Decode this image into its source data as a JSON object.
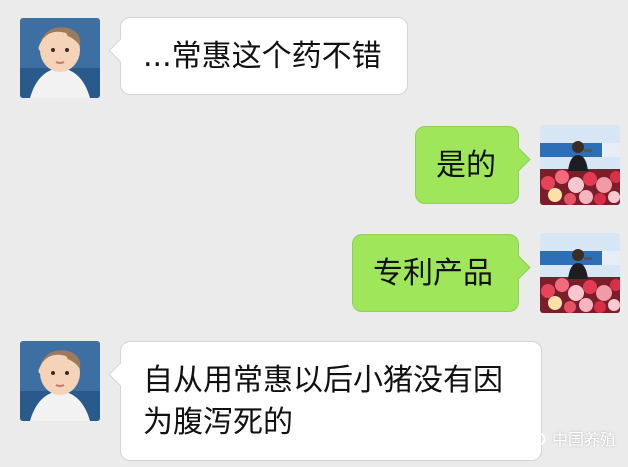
{
  "chat": {
    "messages": [
      {
        "side": "left",
        "sender": "baby-avatar",
        "text": "...常惠这个药不错"
      },
      {
        "side": "right",
        "sender": "speaker-avatar",
        "text": "是的"
      },
      {
        "side": "right",
        "sender": "speaker-avatar",
        "text": "专利产品"
      },
      {
        "side": "left",
        "sender": "baby-avatar",
        "text_line1": "自从用常惠以后小猪没有因",
        "text_line2": "为腹泻死的"
      }
    ]
  },
  "watermark": {
    "text": "中国养殖",
    "icon": "wechat-icon"
  },
  "colors": {
    "background": "#ebebeb",
    "left_bubble": "#ffffff",
    "right_bubble": "#9fe65a"
  }
}
